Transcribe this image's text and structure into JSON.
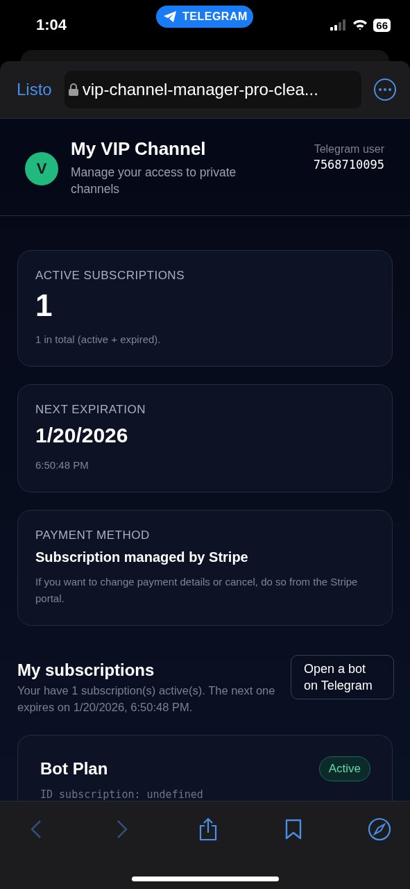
{
  "status_bar": {
    "time": "1:04",
    "app_pill": "TELEGRAM",
    "battery": "66"
  },
  "browser": {
    "done": "Listo",
    "url": "vip-channel-manager-pro-clea..."
  },
  "header": {
    "avatar": "V",
    "title": "My VIP Channel",
    "subtitle": "Manage your access to private channels",
    "user_label": "Telegram user",
    "user_id": "7568710095"
  },
  "cards": [
    {
      "kind": "count",
      "label": "ACTIVE SUBSCRIPTIONS",
      "value": "1",
      "note": "1 in total (active + expired)."
    },
    {
      "kind": "date",
      "label": "NEXT EXPIRATION",
      "value": "1/20/2026",
      "note": "6:50:48 PM"
    },
    {
      "kind": "text",
      "label": "PAYMENT METHOD",
      "value": "Subscription managed by Stripe",
      "note": "If you want to change payment details or cancel, do so from the Stripe portal."
    }
  ],
  "subscriptions": {
    "title": "My subscriptions",
    "summary": "Your have 1 subscription(s) active(s). The next one expires on 1/20/2026, 6:50:48 PM.",
    "button": "Open a bot on Telegram",
    "items": [
      {
        "name": "Bot Plan",
        "status": "Active",
        "active": true,
        "id_line": "ID subscription: undefined"
      }
    ]
  },
  "toolbar": {
    "back_disabled": true,
    "forward_disabled": true
  }
}
